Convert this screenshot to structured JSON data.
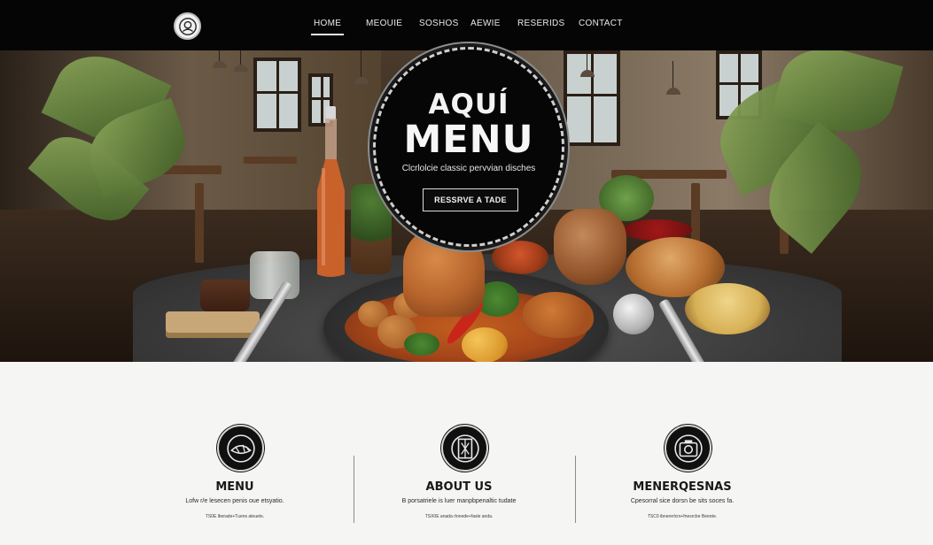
{
  "nav": {
    "items": [
      {
        "label": "HOME",
        "active": true
      },
      {
        "label": "MEOUIE",
        "active": false
      },
      {
        "label": "SOSHOS",
        "active": false
      },
      {
        "label": "AEWIE",
        "active": false
      },
      {
        "label": "RESERIDS",
        "active": false
      },
      {
        "label": "CONTACT",
        "active": false
      }
    ]
  },
  "hero": {
    "badge_title_line1": "AQUÍ",
    "badge_title_line2": "MENU",
    "tagline": "Clcrlolcie classic pervvian disches",
    "cta_label": "RESSRVE A TADE"
  },
  "features": [
    {
      "icon": "food-emblem-icon",
      "title": "MENU",
      "desc": "Lofw r/e lesecen penis oue etsyatio.",
      "meta": "TS0E  lberade+Tuens  ateuets."
    },
    {
      "icon": "portrait-emblem-icon",
      "title": "ABOUT US",
      "desc": "B porsatriele is luer manpbpenaltic tudate",
      "meta": "TSX0E  anada rlonede+fasle  anda."
    },
    {
      "icon": "camera-emblem-icon",
      "title": "MENERQESNAS",
      "desc": "Cpesorral sice dorsn be sits soces fa.",
      "meta": "TSC0 ibnererlcrs+fnesrcbe  Beeote."
    }
  ],
  "colors": {
    "nav_bg": "#050505",
    "badge_bg": "#060606",
    "lower_bg": "#f5f5f4",
    "text_dark": "#191919"
  }
}
